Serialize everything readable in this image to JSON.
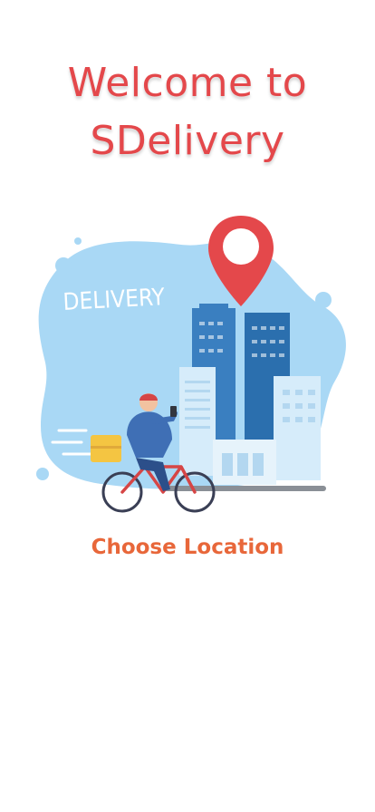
{
  "welcome": {
    "line1": "Welcome to",
    "line2": "SDelivery"
  },
  "illustration": {
    "badge_text": "DELIVERY",
    "icon": "map-pin-icon"
  },
  "actions": {
    "choose_location": "Choose Location"
  },
  "colors": {
    "title": "#e4484b",
    "action": "#e8673a",
    "pin": "#e4484b",
    "blob": "#a9d8f5"
  }
}
